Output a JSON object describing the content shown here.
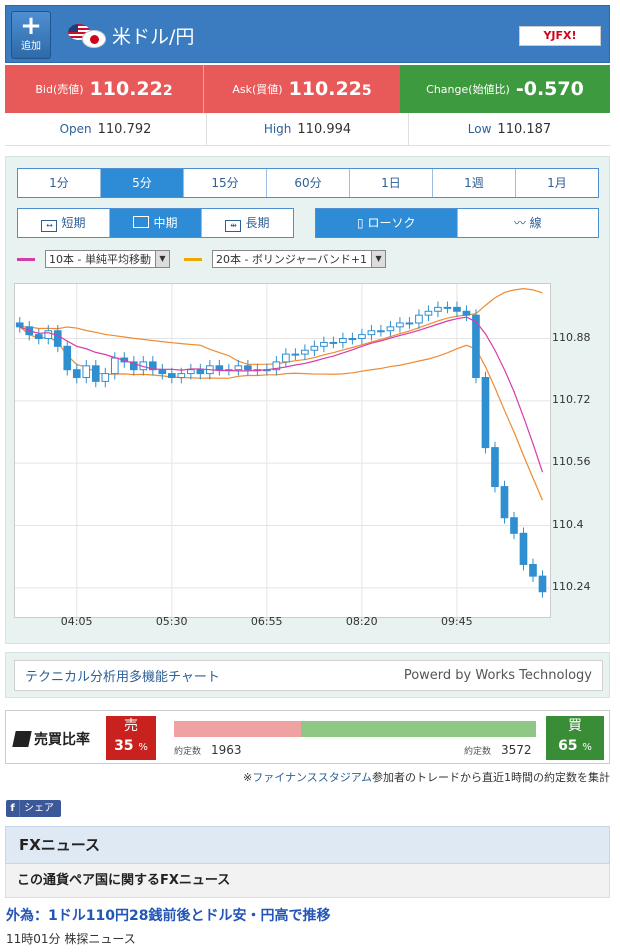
{
  "header": {
    "add_label": "追加",
    "pair_title": "米ドル/円",
    "logo_text": "YJFX!"
  },
  "quote": {
    "bid_label": "Bid(売値)",
    "bid_main": "110.22",
    "bid_pip": "2",
    "ask_label": "Ask(買値)",
    "ask_main": "110.22",
    "ask_pip": "5",
    "change_label": "Change(始値比)",
    "change_value": "-0.570"
  },
  "ohl": {
    "open_label": "Open",
    "open_main": "110.79",
    "open_pip": "2",
    "high_label": "High",
    "high_main": "110.99",
    "high_pip": "4",
    "low_label": "Low",
    "low_main": "110.18",
    "low_pip": "7"
  },
  "timeframes": [
    "1分",
    "5分",
    "15分",
    "60分",
    "1日",
    "1週",
    "1月"
  ],
  "active_timeframe": "5分",
  "ranges": [
    {
      "label": "短期",
      "icon": "short-range-icon"
    },
    {
      "label": "中期",
      "icon": "mid-range-icon"
    },
    {
      "label": "長期",
      "icon": "long-range-icon"
    }
  ],
  "chart_types": [
    {
      "label": "ローソク",
      "icon": "candlestick-icon"
    },
    {
      "label": "線",
      "icon": "line-chart-icon"
    }
  ],
  "indicators": [
    {
      "value": "10本 - 単純平均移動",
      "color": "#d63ca8"
    },
    {
      "value": "20本 - ボリンジャーバンド+1",
      "color": "#f0a800"
    }
  ],
  "chart_data": {
    "type": "candlestick",
    "x_ticks": [
      "04:05",
      "05:30",
      "06:55",
      "08:20",
      "09:45"
    ],
    "y_ticks": [
      "110.88",
      "110.72",
      "110.56",
      "110.4",
      "110.24"
    ],
    "ylim": [
      110.16,
      111.02
    ],
    "grid": true,
    "up_color": "#2f8fd0",
    "ma_color": "#d63ca8",
    "band_color": "#f08a30",
    "close": [
      110.91,
      110.89,
      110.88,
      110.9,
      110.86,
      110.8,
      110.78,
      110.81,
      110.77,
      110.79,
      110.83,
      110.82,
      110.8,
      110.82,
      110.8,
      110.79,
      110.78,
      110.79,
      110.8,
      110.79,
      110.81,
      110.8,
      110.8,
      110.81,
      110.8,
      110.8,
      110.8,
      110.82,
      110.84,
      110.84,
      110.85,
      110.86,
      110.87,
      110.87,
      110.88,
      110.88,
      110.89,
      110.9,
      110.9,
      110.91,
      110.92,
      110.92,
      110.94,
      110.95,
      110.96,
      110.96,
      110.95,
      110.94,
      110.78,
      110.6,
      110.5,
      110.42,
      110.38,
      110.3,
      110.27,
      110.23
    ]
  },
  "tech": {
    "link": "テクニカル分析用多機能チャート",
    "credit": "Powerd by Works Technology"
  },
  "ratio": {
    "title": "売買比率",
    "sell_label": "売",
    "sell_pct": "35",
    "sell_count_label": "約定数",
    "sell_count": "1963",
    "buy_label": "買",
    "buy_pct": "65",
    "buy_count_label": "約定数",
    "buy_count": "3572",
    "pct_unit": "%",
    "note_prefix": "※",
    "note_link": "ファイナンススタジアム",
    "note_suffix": "参加者のトレードから直近1時間の約定数を集計"
  },
  "share": {
    "label": "シェア"
  },
  "news": {
    "heading": "FXニュース",
    "sub": "この通貨ペア国に関するFXニュース",
    "title": "外為：1ドル110円28銭前後とドル安・円高で推移",
    "meta": "11時01分 株探ニュース"
  }
}
